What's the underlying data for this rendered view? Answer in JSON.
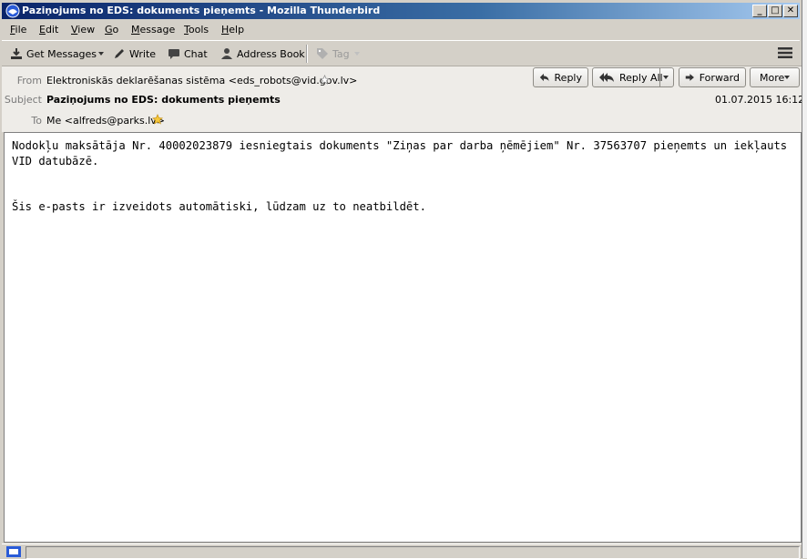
{
  "window": {
    "title": "Paziņojums no EDS: dokuments pieņemts - Mozilla Thunderbird",
    "minimize_glyph": "_",
    "maximize_glyph": "□",
    "close_glyph": "✕"
  },
  "menu": {
    "file": {
      "u": "F",
      "rest": "ile"
    },
    "edit": {
      "u": "E",
      "rest": "dit"
    },
    "view": {
      "u": "V",
      "rest": "iew"
    },
    "go": {
      "u": "G",
      "rest": "o"
    },
    "message": {
      "u": "M",
      "rest": "essage"
    },
    "tools": {
      "u": "T",
      "rest": "ools"
    },
    "help": {
      "u": "H",
      "rest": "elp"
    }
  },
  "toolbar": {
    "get_messages": "Get Messages",
    "write": "Write",
    "chat": "Chat",
    "address_book": "Address Book",
    "tag": "Tag"
  },
  "header": {
    "from_label": "From",
    "from_value": "Elektroniskās deklarēšanas sistēma <eds_robots@vid.gov.lv>",
    "subject_label": "Subject",
    "subject_value": "Paziņojums no EDS: dokuments pieņemts",
    "to_label": "To",
    "to_value": "Me <alfreds@parks.lv>",
    "date": "01.07.2015 16:12",
    "buttons": {
      "reply": "Reply",
      "reply_all": "Reply All",
      "forward": "Forward",
      "more": "More"
    }
  },
  "message": {
    "line1": "Nodokļu maksātāja Nr. 40002023879 iesniegtais dokuments \"Ziņas par darba ņēmējiem\" Nr. 37563707 pieņemts un iekļauts VID datubāzē.",
    "line2": "Šis e-pasts ir izveidots automātiski, lūdzam uz to neatbildēt."
  },
  "colors": {
    "titlebar_start": "#0a246a",
    "titlebar_end": "#a6caf0",
    "chrome": "#d4d0c8",
    "header_bg": "#eeece8"
  }
}
